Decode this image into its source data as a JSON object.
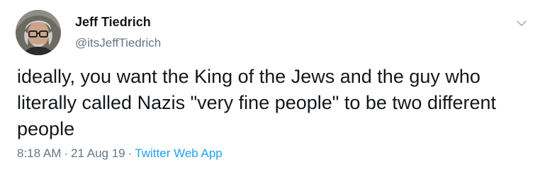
{
  "author": {
    "display_name": "Jeff Tiedrich",
    "handle": "@itsJeffTiedrich",
    "avatar_icon": "profile-photo"
  },
  "tweet": {
    "text": "ideally, you want the King of the Jews and the guy who\nliterally called Nazis \"very fine people\" to be two different\npeople"
  },
  "meta": {
    "time": "8:18 AM",
    "separator": "·",
    "date": "21 Aug 19",
    "source": "Twitter Web App"
  },
  "menu": {
    "icon": "chevron-down-icon"
  },
  "colors": {
    "text": "#14171a",
    "muted": "#657786",
    "link": "#1da1f2"
  }
}
